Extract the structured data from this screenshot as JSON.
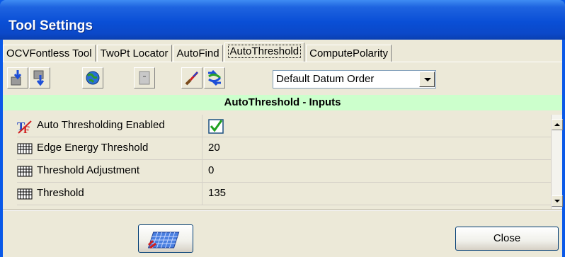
{
  "window": {
    "title": "Tool Settings"
  },
  "tabs": [
    {
      "label": "OCVFontless Tool",
      "active": false
    },
    {
      "label": "TwoPt Locator",
      "active": false
    },
    {
      "label": "AutoFind",
      "active": false
    },
    {
      "label": "AutoThreshold",
      "active": true
    },
    {
      "label": "ComputePolarity",
      "active": false
    }
  ],
  "toolbar": {
    "icons": [
      "import-icon",
      "export-icon",
      "globe-icon",
      "disabled-page-icon",
      "brush-icon",
      "cycle-icon"
    ],
    "datum_combo": {
      "selected": "Default Datum Order"
    }
  },
  "section": {
    "title": "AutoThreshold - Inputs"
  },
  "properties": [
    {
      "label": "Auto Thresholding Enabled",
      "value": "",
      "icon": "tf-icon",
      "checked": true
    },
    {
      "label": "Edge Energy Threshold",
      "value": "20",
      "icon": "keyboard-icon"
    },
    {
      "label": "Threshold Adjustment",
      "value": "0",
      "icon": "keyboard-icon"
    },
    {
      "label": "Threshold",
      "value": "135",
      "icon": "keyboard-icon"
    }
  ],
  "buttons": {
    "close_label": "Close"
  },
  "colors": {
    "titlebar": "#0a4fd6",
    "section_header_bg": "#ccffcc",
    "client_bg": "#ece9d8"
  }
}
